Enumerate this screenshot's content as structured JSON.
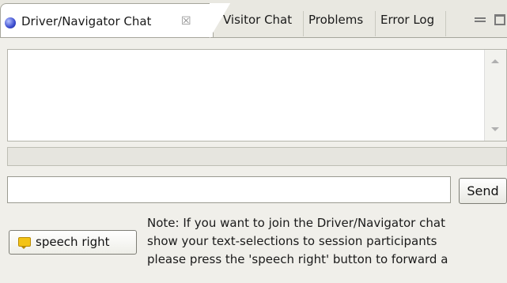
{
  "tabs": {
    "active": {
      "label": "Driver/Navigator Chat",
      "icon": "chat-globe-icon",
      "close_glyph": "☒"
    },
    "others": [
      "Visitor Chat",
      "Problems",
      "Error Log"
    ]
  },
  "chat": {
    "messages": []
  },
  "input": {
    "value": "",
    "send_label": "Send"
  },
  "speech": {
    "button_label": "speech right",
    "icon": "speech-bubble-icon"
  },
  "note": {
    "lines": [
      "Note: If you want to join the Driver/Navigator chat",
      "show your text-selections to session participants",
      "please press the 'speech right' button to forward a"
    ]
  },
  "colors": {
    "window_bg": "#f0efea",
    "tab_active_bg": "#ffffff",
    "speech_icon": "#f3c316"
  }
}
